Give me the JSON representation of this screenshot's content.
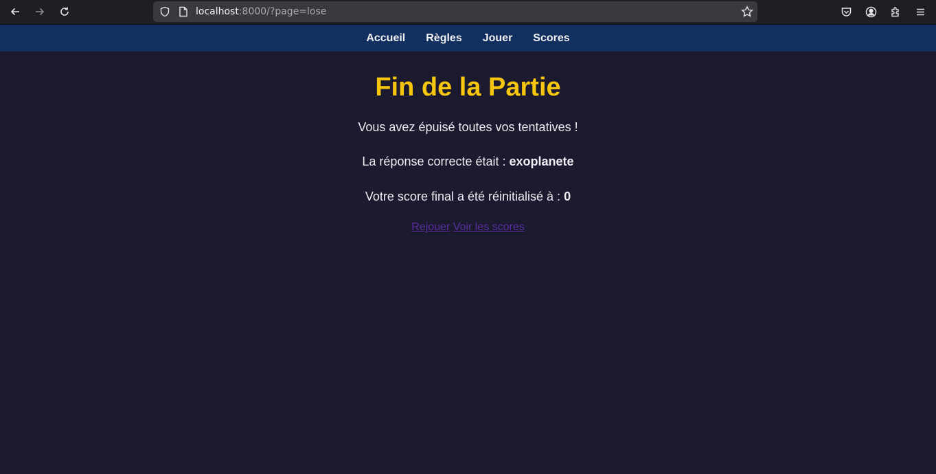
{
  "browser": {
    "url_host": "localhost",
    "url_rest": ":8000/?page=lose",
    "icons": [
      "back-arrow-icon",
      "forward-arrow-icon",
      "reload-icon",
      "shield-icon",
      "page-icon",
      "star-icon",
      "pocket-icon",
      "account-icon",
      "extensions-icon",
      "menu-icon"
    ]
  },
  "nav": {
    "items": [
      {
        "label": "Accueil"
      },
      {
        "label": "Règles"
      },
      {
        "label": "Jouer"
      },
      {
        "label": "Scores"
      }
    ]
  },
  "main": {
    "title": "Fin de la Partie",
    "line1": "Vous avez épuisé toutes vos tentatives !",
    "line2_prefix": "La réponse correcte était : ",
    "line2_answer": "exoplanete",
    "line3_prefix": "Votre score final a été réinitialisé à : ",
    "line3_score": "0",
    "link_replay": "Rejouer",
    "link_scores": "Voir les scores"
  },
  "colors": {
    "background": "#1b1a2e",
    "nav_bg": "#12305f",
    "title": "#f6c50d",
    "link": "#5a2e9f"
  }
}
